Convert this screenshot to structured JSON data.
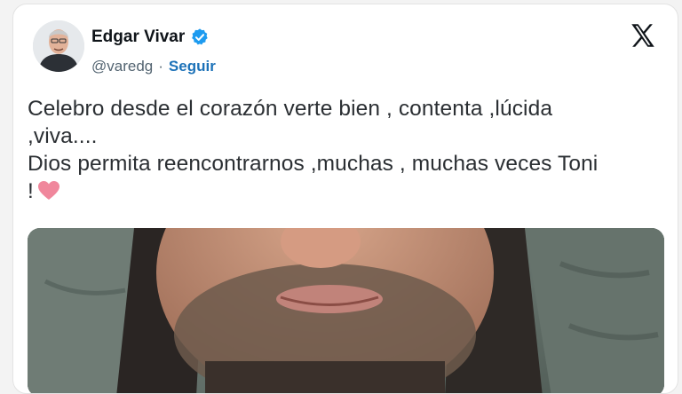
{
  "author": {
    "name": "Edgar Vivar",
    "handle": "@varedg",
    "separator": "·",
    "follow_label": "Seguir",
    "verified_color": "#1d9bf0"
  },
  "icons": {
    "avatar": "profile-photo",
    "verified": "verified-badge-icon",
    "logo": "x-logo-icon",
    "emoji": "pink-heart-emoji"
  },
  "tweet": {
    "lines": [
      "Celebro desde el corazón verte bien , contenta ,lúcida",
      ",viva....",
      "Dios permita reencontrarnos ,muchas , muchas veces Toni",
      "!"
    ]
  },
  "media": {
    "description_icon": "photo"
  },
  "colors": {
    "card_bg": "#ffffff",
    "follow_link": "#1d72b8",
    "heart": "#f0879c"
  }
}
